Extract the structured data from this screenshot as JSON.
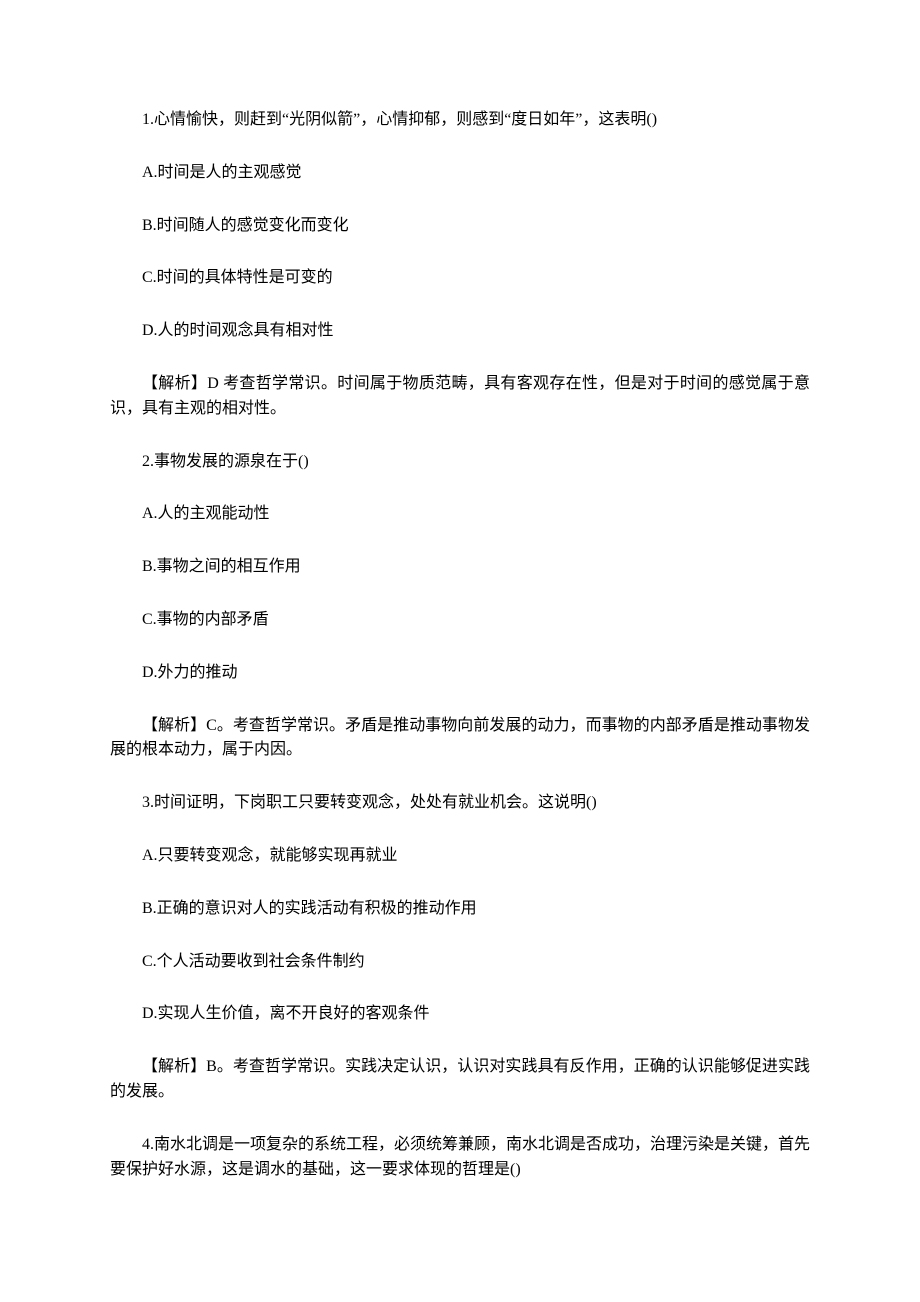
{
  "paragraphs": [
    "1.心情愉快，则赶到“光阴似箭”，心情抑郁，则感到“度日如年”，这表明()",
    "A.时间是人的主观感觉",
    "B.时间随人的感觉变化而变化",
    "C.时间的具体特性是可变的",
    "D.人的时间观念具有相对性",
    "【解析】D 考查哲学常识。时间属于物质范畴，具有客观存在性，但是对于时间的感觉属于意识，具有主观的相对性。",
    "2.事物发展的源泉在于()",
    "A.人的主观能动性",
    "B.事物之间的相互作用",
    "C.事物的内部矛盾",
    "D.外力的推动",
    "【解析】C。考查哲学常识。矛盾是推动事物向前发展的动力，而事物的内部矛盾是推动事物发展的根本动力，属于内因。",
    "3.时间证明，下岗职工只要转变观念，处处有就业机会。这说明()",
    "A.只要转变观念，就能够实现再就业",
    "B.正确的意识对人的实践活动有积极的推动作用",
    "C.个人活动要收到社会条件制约",
    "D.实现人生价值，离不开良好的客观条件",
    "【解析】B。考查哲学常识。实践决定认识，认识对实践具有反作用，正确的认识能够促进实践的发展。",
    "4.南水北调是一项复杂的系统工程，必须统筹兼顾，南水北调是否成功，治理污染是关键，首先要保护好水源，这是调水的基础，这一要求体现的哲理是()"
  ]
}
